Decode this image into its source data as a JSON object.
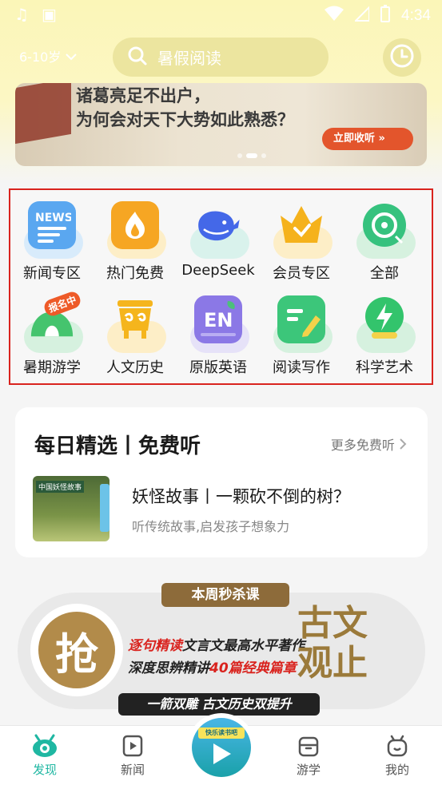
{
  "status_bar": {
    "time": "4:34"
  },
  "header": {
    "age_label": "6-10岁",
    "search_placeholder": "暑假阅读"
  },
  "banner": {
    "line1": "诸葛亮足不出户，",
    "line2": "为何会对天下大势如此熟悉？",
    "cta": "立即收听"
  },
  "categories": [
    {
      "label": "新闻专区",
      "icon": "news-icon",
      "color": "#5aa7f0",
      "bg": "#d8ebfb"
    },
    {
      "label": "热门免费",
      "icon": "fire-icon",
      "color": "#f6a623",
      "bg": "#fdeec7"
    },
    {
      "label": "DeepSeek",
      "icon": "whale-icon",
      "color": "#4468e8",
      "bg": "#d9f2ec"
    },
    {
      "label": "会员专区",
      "icon": "crown-icon",
      "color": "#f5b21c",
      "bg": "#fdeec7"
    },
    {
      "label": "全部",
      "icon": "disc-icon",
      "color": "#36c27e",
      "bg": "#d6f1df"
    },
    {
      "label": "暑期游学",
      "icon": "tent-icon",
      "color": "#45c46e",
      "bg": "#d6f1df",
      "badge": "报名中"
    },
    {
      "label": "人文历史",
      "icon": "vessel-icon",
      "color": "#f5b51d",
      "bg": "#fdeec7"
    },
    {
      "label": "原版英语",
      "icon": "en-book-icon",
      "color": "#8b78e6",
      "bg": "#e6e2f8"
    },
    {
      "label": "阅读写作",
      "icon": "notebook-pen-icon",
      "color": "#3cc67a",
      "bg": "#d6f1df"
    },
    {
      "label": "科学艺术",
      "icon": "lightning-icon",
      "color": "#33c46c",
      "bg": "#d6f1df"
    }
  ],
  "daily": {
    "title": "每日精选丨免费听",
    "more": "更多免费听",
    "cover_text": "中国妖怪故事",
    "item_title": "妖怪故事丨一颗砍不倒的树？",
    "item_subtitle": "听传统故事,启发孩子想象力"
  },
  "promo": {
    "tag": "本周秒杀课",
    "grab": "抢",
    "line1_red": "逐句精读",
    "line1_rest": "文言文最高水平著作",
    "line2_pre": "深度思辨精讲",
    "line2_red": "40篇经典篇章",
    "big_text": "古文观止",
    "bottom": "一箭双雕 古文历史双提升"
  },
  "nav": [
    {
      "label": "发现",
      "icon": "discover-icon",
      "active": true
    },
    {
      "label": "新闻",
      "icon": "news-video-icon"
    },
    {
      "label": "",
      "icon": "play-center-icon",
      "center_tag": "快乐读书吧"
    },
    {
      "label": "游学",
      "icon": "backpack-icon"
    },
    {
      "label": "我的",
      "icon": "profile-icon"
    }
  ],
  "colors": {
    "accent": "#1fb7a2",
    "highlight_border": "#d9231e"
  }
}
